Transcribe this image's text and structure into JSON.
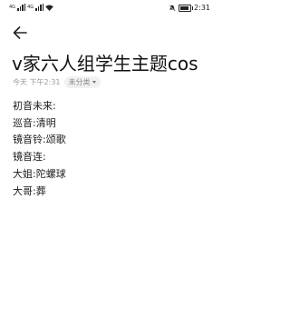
{
  "status_bar": {
    "sim_label_1": "4G",
    "sim_label_2": "4G",
    "time": "2:31",
    "battery_level": 0.85
  },
  "note": {
    "title": "v家六人组学生主题cos",
    "date": "今天 下午2:31",
    "category": "未分类",
    "lines": [
      "初音未来:",
      "巡音:清明",
      "镜音铃:颂歌",
      "镜音连:",
      "大姐:陀螺球",
      "大哥:葬"
    ]
  },
  "icons": {
    "back": "arrow-left-icon",
    "mute": "bell-off-icon",
    "dropdown": "triangle-down-icon"
  }
}
